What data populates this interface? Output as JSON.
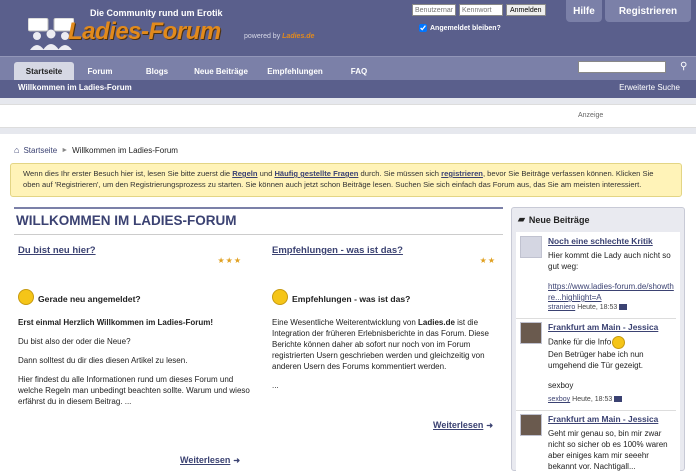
{
  "header": {
    "tagline": "Die Community rund um Erotik",
    "brand": "Ladies-Forum",
    "powered_by": "powered by",
    "powered_brand": "Ladies.de",
    "username_placeholder": "Benutzername",
    "password_placeholder": "Kennwort",
    "login_label": "Anmelden",
    "remember_label": "Angemeldet bleiben?",
    "help_label": "Hilfe",
    "register_label": "Registrieren"
  },
  "nav": {
    "tabs": [
      {
        "label": "Startseite"
      },
      {
        "label": "Forum"
      },
      {
        "label": "Blogs"
      },
      {
        "label": "Neue Beiträge"
      },
      {
        "label": "Empfehlungen"
      },
      {
        "label": "FAQ"
      }
    ],
    "welcome": "Willkommen im Ladies-Forum",
    "advanced_search": "Erweiterte Suche"
  },
  "ad_label": "Anzeige",
  "breadcrumb": {
    "home": "Startseite",
    "current": "Willkommen im Ladies-Forum"
  },
  "notice": {
    "t1": "Wenn dies Ihr erster Besuch hier ist, lesen Sie bitte zuerst die ",
    "regeln": "Regeln",
    "t2": " und ",
    "faq": "Häufig gestellte Fragen",
    "t3": " durch. Sie müssen sich ",
    "register": "registrieren",
    "t4": ", bevor Sie Beiträge verfassen können. Klicken Sie oben auf 'Registrieren', um den Registrierungsprozess zu starten. Sie können auch jetzt schon Beiträge lesen. Suchen Sie sich einfach das Forum aus, das Sie am meisten interessiert."
  },
  "welcome": {
    "title": "WILLKOMMEN IM LADIES-FORUM",
    "left": {
      "title": "Du bist neu hier?",
      "stars": "★★★",
      "subtitle": "Gerade neu angemeldet?",
      "p1": "Erst einmal Herzlich Willkommen im Ladies-Forum!",
      "p2": "Du bist also der oder die Neue?",
      "p3": "Dann solltest du dir dies diesen Artikel zu lesen.",
      "p4": "Hier findest du alle Informationen rund um dieses Forum und welche Regeln man unbedingt beachten sollte. Warum und wieso erfährst du in diesem Beitrag. ...",
      "more": "Weiterlesen"
    },
    "right": {
      "title": "Empfehlungen - was ist das?",
      "stars": "★★",
      "subtitle": "Empfehlungen - was ist das?",
      "p1a": "Eine Wesentliche Weiterentwicklung von ",
      "p1b": "Ladies.de",
      "p1c": " ist die Integration der früheren Erlebnisberichte in das Forum. Diese Berichte können daher ab sofort nur noch von im Forum registrierten Usern geschrieben werden und gleichzeitig von anderen Usern des Forums kommentiert werden.",
      "p2": "...",
      "more": "Weiterlesen"
    }
  },
  "sidebar": {
    "title": "Neue Beiträge",
    "posts": [
      {
        "title": "Noch eine schlechte Kritik",
        "text": "Hier kommt die Lady auch nicht so gut weg:",
        "link": "https://www.ladies-forum.de/showthre...highlight=A",
        "user": "straniero",
        "time": "Heute, 18:53"
      },
      {
        "title": "Frankfurt am Main - Jessica",
        "text": "Danke für die Info",
        "text2": "Den Betrüger habe ich nun umgehend die Tür gezeigt.",
        "text3": "sexboy",
        "user": "sexboy",
        "time": "Heute, 18:53"
      },
      {
        "title": "Frankfurt am Main - Jessica",
        "text": "Geht mir genau so, bin mir zwar nicht so sicher ob es 100% waren aber einiges kam mir seeehr bekannt vor. Nachtigall..."
      }
    ]
  }
}
